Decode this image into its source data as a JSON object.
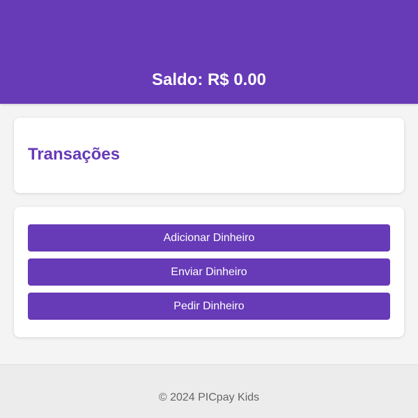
{
  "header": {
    "balance_text": "Saldo: R$ 0.00"
  },
  "transactions": {
    "title": "Transações"
  },
  "actions": {
    "add_label": "Adicionar Dinheiro",
    "send_label": "Enviar Dinheiro",
    "request_label": "Pedir Dinheiro"
  },
  "footer": {
    "copyright": "© 2024 PICpay Kids"
  },
  "colors": {
    "brand": "#673ab7",
    "background": "#f4f4f4",
    "card": "#ffffff",
    "footer": "#ececec",
    "footer_text": "#666666"
  }
}
